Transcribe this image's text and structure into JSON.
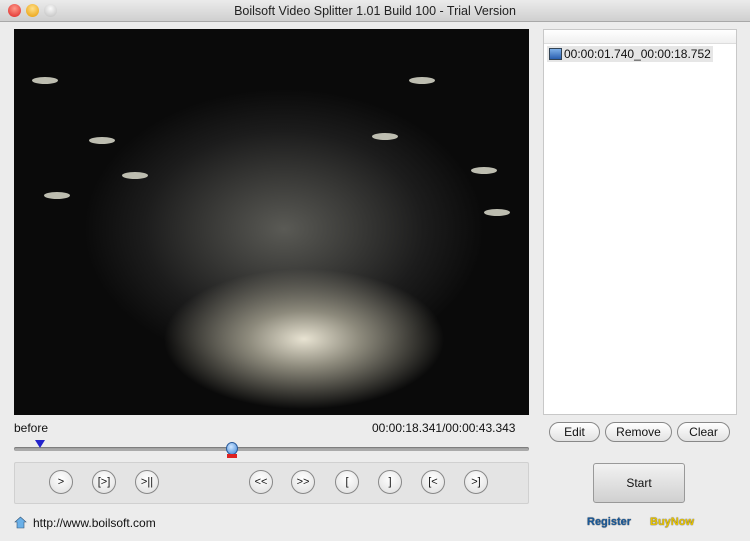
{
  "window": {
    "title": "Boilsoft Video Splitter 1.01 Build 100 - Trial Version"
  },
  "segments": [
    {
      "label": "00:00:01.740_00:00:18.752"
    }
  ],
  "list_buttons": {
    "edit": "Edit",
    "remove": "Remove",
    "clear": "Clear"
  },
  "player": {
    "mode_label": "before",
    "time_display": "00:00:18.341/00:00:43.343",
    "position_fraction": 0.423,
    "start_marker_fraction": 0.05
  },
  "controls": [
    ">",
    "[>]",
    ">||",
    "<<",
    ">>",
    "[",
    "]",
    "[<",
    ">]"
  ],
  "start_label": "Start",
  "footer": {
    "url": "http://www.boilsoft.com",
    "register": "Register",
    "buynow": "BuyNow"
  }
}
